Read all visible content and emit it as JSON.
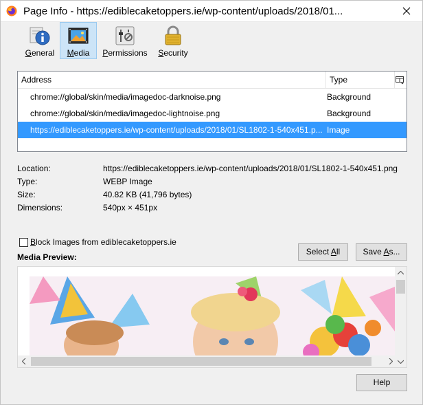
{
  "window": {
    "title": "Page Info - https://ediblecaketoppers.ie/wp-content/uploads/2018/01..."
  },
  "tabs": [
    {
      "label": "General",
      "accel": "G",
      "rest": "eneral",
      "icon": "info-icon",
      "selected": false
    },
    {
      "label": "Media",
      "accel": "M",
      "rest": "edia",
      "icon": "media-icon",
      "selected": true
    },
    {
      "label": "Permissions",
      "accel": "P",
      "rest": "ermissions",
      "icon": "permissions-icon",
      "selected": false
    },
    {
      "label": "Security",
      "accel": "S",
      "rest": "ecurity",
      "icon": "lock-icon",
      "selected": false
    }
  ],
  "media_list": {
    "columns": [
      "Address",
      "Type"
    ],
    "rows": [
      {
        "address": "chrome://global/skin/media/imagedoc-darknoise.png",
        "type": "Background",
        "selected": false
      },
      {
        "address": "chrome://global/skin/media/imagedoc-lightnoise.png",
        "type": "Background",
        "selected": false
      },
      {
        "address": "https://ediblecaketoppers.ie/wp-content/uploads/2018/01/SL1802-1-540x451.p...",
        "type": "Image",
        "selected": true
      }
    ]
  },
  "details": {
    "location_label": "Location:",
    "location_value": "https://ediblecaketoppers.ie/wp-content/uploads/2018/01/SL1802-1-540x451.png",
    "type_label": "Type:",
    "type_value": "WEBP Image",
    "size_label": "Size:",
    "size_value": "40.82 KB (41,796 bytes)",
    "dimensions_label": "Dimensions:",
    "dimensions_value": "540px × 451px"
  },
  "block": {
    "label": "Block Images from ediblecaketoppers.ie",
    "accel": "B",
    "rest": "lock Images from ediblecaketoppers.ie",
    "checked": false
  },
  "buttons": {
    "select_all_pre": "Select ",
    "select_all_accel": "A",
    "select_all_post": "ll",
    "save_as_pre": "Save ",
    "save_as_accel": "A",
    "save_as_post": "s...",
    "help": "Help"
  },
  "preview": {
    "label": "Media Preview:"
  },
  "colors": {
    "selection": "#3399ff",
    "tab_selected": "#cce4f7"
  }
}
